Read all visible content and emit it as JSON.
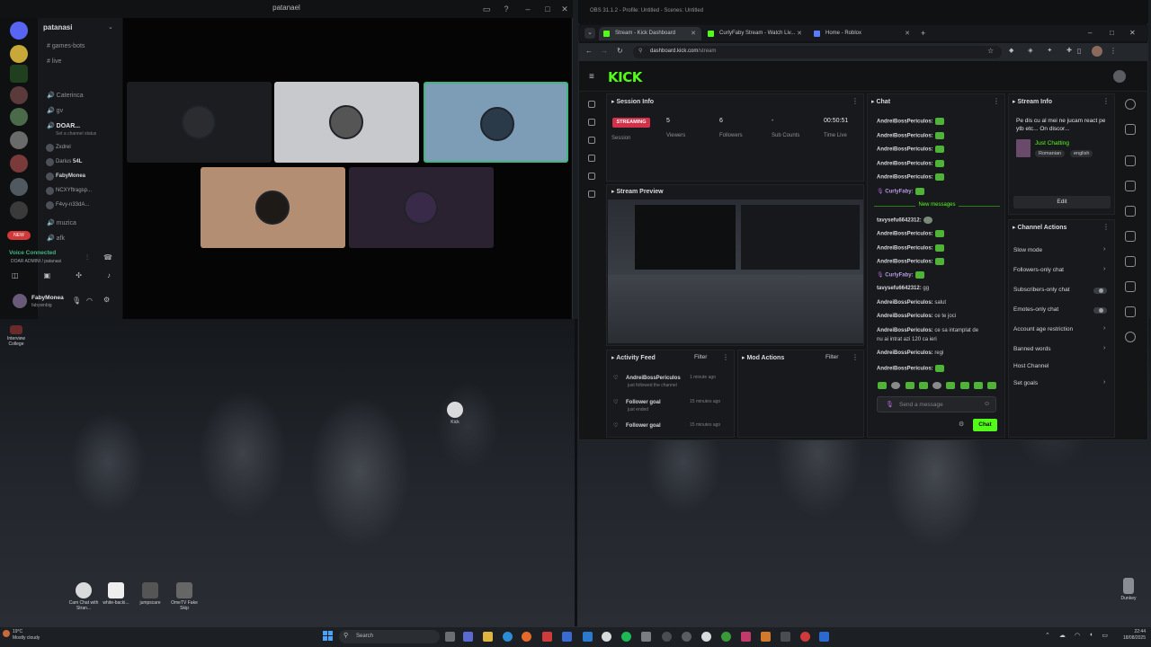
{
  "discord": {
    "title": "patanael",
    "server_name": "patanasi",
    "channels": [
      "games-bots",
      "live"
    ],
    "voice_users_top": [
      "Caterinca",
      "gv"
    ],
    "voice_channel": "DOAR...",
    "voice_status": "Set a channel status",
    "voice_members": [
      {
        "name": "Zxdrel",
        "extra": ""
      },
      {
        "name": "Darius",
        "extra": "54L"
      },
      {
        "name": "FabyMonea",
        "extra": ""
      },
      {
        "name": "NCXYftragsp...",
        "extra": ""
      },
      {
        "name": "F4vy-n33dA...",
        "extra": ""
      }
    ],
    "other_channels": [
      "muzica",
      "afk"
    ],
    "voice_connected": "Voice Connected",
    "voice_connected_sub": "DOAR ADMINI / patanasi",
    "user_name": "FabyMonea",
    "user_status": "fabywnbig",
    "new_badge": "NEW"
  },
  "browser": {
    "obs_title": "OBS 31.1.2 - Profile: Untitled - Scenes: Untitled",
    "tabs": [
      {
        "label": "Stream - Kick Dashboard",
        "color": "#53fc18"
      },
      {
        "label": "CurlyFaby Stream - Watch Liv...",
        "color": "#53fc18"
      },
      {
        "label": "Home - Roblox",
        "color": "#5b7cfa"
      }
    ],
    "url_host": "dashboard.kick.com",
    "url_path": "/stream"
  },
  "kick": {
    "logo": "KICK",
    "session_info": {
      "title": "Session Info",
      "badge": "STREAMING",
      "session_label": "Session",
      "stats": [
        {
          "value": "5",
          "label": "Viewers"
        },
        {
          "value": "6",
          "label": "Followers"
        },
        {
          "value": "-",
          "label": "Sub Counts"
        },
        {
          "value": "00:50:51",
          "label": "Time Live"
        }
      ]
    },
    "stream_preview_title": "Stream Preview",
    "activity_feed": {
      "title": "Activity Feed",
      "filter": "Filter",
      "items": [
        {
          "name": "AndreiBossPericulos",
          "sub": "just followed the channel",
          "time": "1 minute ago"
        },
        {
          "name": "Follower goal",
          "sub": "just ended",
          "time": "15 minutes ago"
        },
        {
          "name": "Follower goal",
          "sub": "just started",
          "time": "15 minutes ago"
        }
      ]
    },
    "mod_actions": {
      "title": "Mod Actions",
      "filter": "Filter"
    },
    "chat": {
      "title": "Chat",
      "lines_before": [
        {
          "name": "AndreiBossPericulos:",
          "text": ""
        },
        {
          "name": "AndreiBossPericulos:",
          "text": ""
        },
        {
          "name": "AndreiBossPericulos:",
          "text": ""
        },
        {
          "name": "AndreiBossPericulos:",
          "text": ""
        },
        {
          "name": "AndreiBossPericulos:",
          "text": ""
        },
        {
          "name": "CurlyFaby:",
          "text": ""
        }
      ],
      "new_messages": "New messages",
      "lines_after": [
        {
          "name": "tavysefu6642312:",
          "text": ""
        },
        {
          "name": "AndreiBossPericulos:",
          "text": ""
        },
        {
          "name": "AndreiBossPericulos:",
          "text": ""
        },
        {
          "name": "AndreiBossPericulos:",
          "text": ""
        },
        {
          "name": "CurlyFaby:",
          "text": ""
        },
        {
          "name": "tavysefu6642312:",
          "text": "gg"
        },
        {
          "name": "AndreiBossPericulos:",
          "text": "salut"
        },
        {
          "name": "AndreiBossPericulos:",
          "text": "ce te joci"
        },
        {
          "name": "AndreiBossPericulos:",
          "text": "ce sa intamplat de"
        },
        {
          "name": "",
          "text": "nu ai intrat azi 120 ca ieri"
        },
        {
          "name": "AndreiBossPericulos:",
          "text": "regi"
        },
        {
          "name": "AndreiBossPericulos:",
          "text": ""
        }
      ],
      "input_placeholder": "Send a message",
      "send_label": "Chat"
    },
    "stream_info": {
      "title": "Stream Info",
      "stream_title": "Pe dis cu al mei ne jucam react pe ytb etc... On discor...",
      "category": "Just Chatting",
      "tags": [
        "Romanian",
        "english"
      ],
      "edit_label": "Edit"
    },
    "channel_actions": {
      "title": "Channel Actions",
      "items": [
        {
          "label": "Slow mode",
          "kind": "arrow"
        },
        {
          "label": "Followers-only chat",
          "kind": "arrow"
        },
        {
          "label": "Subscribers-only chat",
          "kind": "toggle"
        },
        {
          "label": "Emotes-only chat",
          "kind": "toggle"
        },
        {
          "label": "Account age restriction",
          "kind": "arrow"
        },
        {
          "label": "Banned words",
          "kind": "arrow"
        },
        {
          "label": "Host Channel",
          "kind": "none"
        },
        {
          "label": "Set goals",
          "kind": "arrow"
        }
      ]
    }
  },
  "desktop": {
    "icons": [
      {
        "label": "Interview College"
      },
      {
        "label": "Kick"
      },
      {
        "label": "Cam Chat with Stran..."
      },
      {
        "label": "white-backi..."
      },
      {
        "label": "jumpscare"
      },
      {
        "label": "OmeTV Fake Skip"
      },
      {
        "label": "Dunkey"
      }
    ]
  },
  "taskbar": {
    "weather_temp": "19°C",
    "weather_desc": "Mostly cloudy",
    "search_label": "Search",
    "time": "22:44",
    "date": "18/08/2025"
  }
}
